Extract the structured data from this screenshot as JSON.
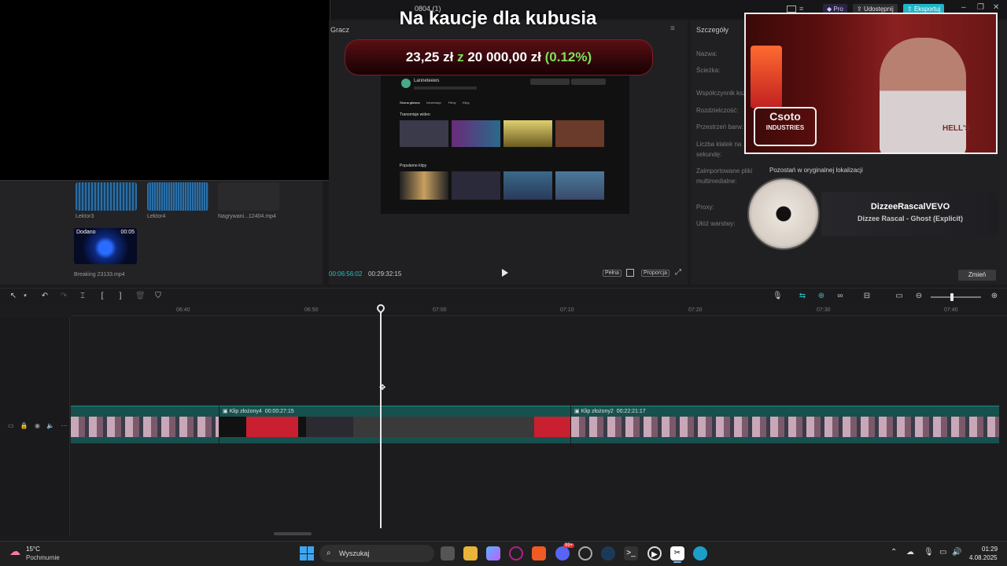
{
  "app": {
    "project_title": "0804 (1)",
    "pro_label": "Pro",
    "share_label": "Udostępnij",
    "export_label": "Eksportuj"
  },
  "media": {
    "items": [
      {
        "label": "Lektor3"
      },
      {
        "label": "Lektor4"
      },
      {
        "label": "Nagrywani...12404.mp4"
      },
      {
        "label": "Breaking 23133.mp4",
        "badge_added": "Dodano",
        "badge_time": "00:05"
      }
    ]
  },
  "player": {
    "header": "Gracz",
    "current_time": "00:06:56:02",
    "total_time": "00:29:32:15",
    "full_label": "Pełna",
    "ratio_label": "Proporcja"
  },
  "donation": {
    "title": "Na kaucje dla kubusia",
    "current": "23,25 zł",
    "separator": "z",
    "goal": "20 000,00 zł",
    "percent": "(0.12%)",
    "colors": {
      "current": "#ffffff",
      "separator": "#7ee05a",
      "percent": "#7ee05a"
    }
  },
  "details": {
    "header": "Szczegóły",
    "labels": [
      "Nazwa:",
      "Ścieżka:",
      "Współczynnik kształtu:",
      "Rozdzielczość:",
      "Przestrzeń barw:",
      "Liczba klatek na",
      "sekundę:",
      "Zaimportowane pliki",
      "multimedialne:",
      "Proxy:",
      "Ułóż warstwy:"
    ],
    "import_value": "Pozostań w oryginalnej lokalizacji",
    "change_label": "Zmień"
  },
  "webcam": {
    "sign_line1": "Csoto",
    "sign_line2": "INDUSTRIES",
    "shirt_text": "HELL'S"
  },
  "music": {
    "artist": "DizzeeRascalVEVO",
    "track": "Dizzee Rascal - Ghost (Explicit)"
  },
  "timeline": {
    "ruler": [
      "06:40",
      "06:50",
      "07:00",
      "07:10",
      "07:20",
      "07:30",
      "07:40"
    ],
    "clips": [
      {
        "label": "Klip złożony4",
        "duration": "00:00:27:15"
      },
      {
        "label": "Klip złożony2",
        "duration": "00:22:21:17"
      }
    ]
  },
  "taskbar": {
    "weather_temp": "15°C",
    "weather_desc": "Pochmurnie",
    "search_placeholder": "Wyszukaj",
    "time": "01:29",
    "date": "4.08.2025",
    "badge_count": "99+"
  },
  "screen_content": {
    "channel_name": "Lanneteews",
    "section_streams": "Transmisje wideo",
    "section_clips": "Popularne klipy",
    "tabs": [
      "Strona główna",
      "Informacje",
      "Filmy",
      "Klipy"
    ]
  }
}
